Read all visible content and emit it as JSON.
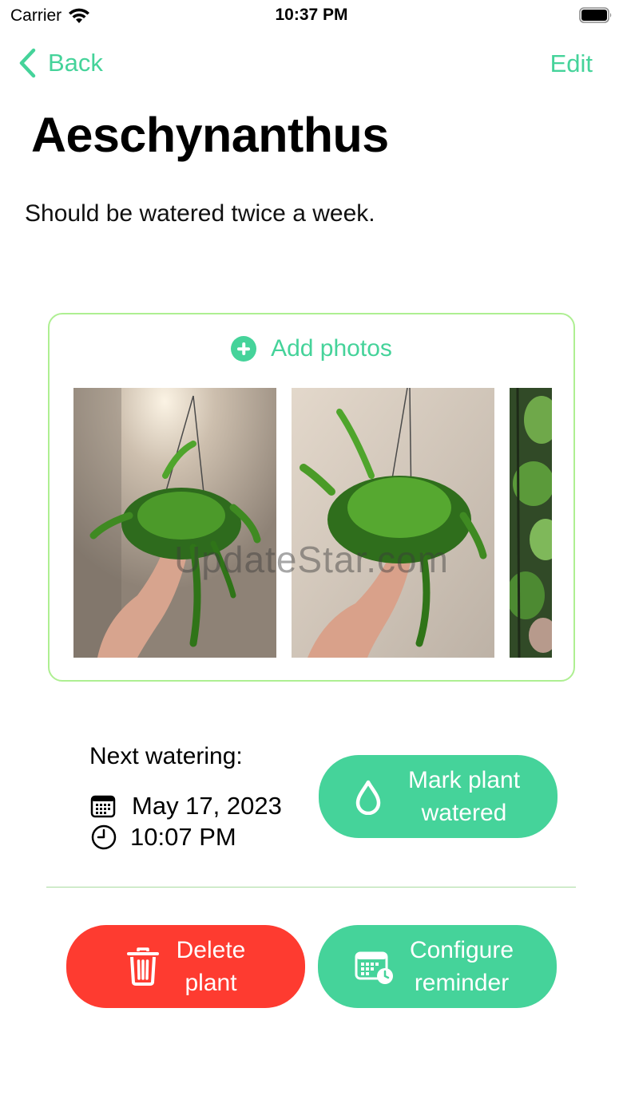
{
  "status_bar": {
    "carrier": "Carrier",
    "time": "10:37 PM"
  },
  "nav": {
    "back_label": "Back",
    "edit_label": "Edit"
  },
  "plant": {
    "name": "Aeschynanthus",
    "description": "Should be watered twice a week."
  },
  "photos": {
    "add_label": "Add photos",
    "watermark": "UpdateStar.com",
    "count_visible": 3
  },
  "watering": {
    "next_label": "Next watering:",
    "date": "May 17, 2023",
    "time": "10:07 PM",
    "mark_line1": "Mark plant",
    "mark_line2": "watered"
  },
  "actions": {
    "delete_line1": "Delete",
    "delete_line2": "plant",
    "config_line1": "Configure",
    "config_line2": "reminder"
  },
  "colors": {
    "accent": "#45d39a",
    "danger": "#fe3b30",
    "card_border": "#aeef92"
  },
  "icons": [
    "wifi-icon",
    "battery-icon",
    "chevron-left-icon",
    "plus-circle-icon",
    "calendar-icon",
    "clock-icon",
    "drop-icon",
    "trash-icon",
    "calendar-clock-icon"
  ]
}
